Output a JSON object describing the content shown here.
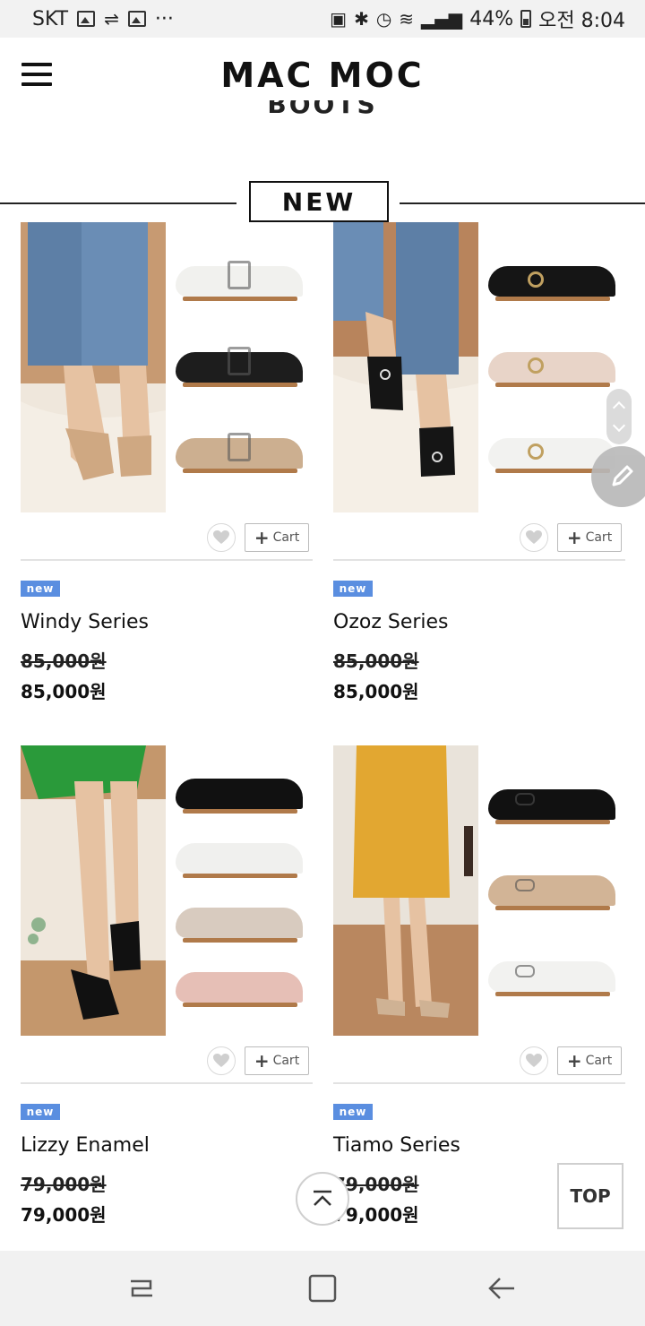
{
  "status_bar": {
    "carrier": "SKT",
    "dots": "···",
    "battery": "44%",
    "time": "오전 8:04"
  },
  "header": {
    "logo": "MAC MOC",
    "cut_heading": "BOOTS"
  },
  "section": {
    "title": "NEW"
  },
  "products": [
    {
      "name": "Windy Series",
      "old_price": "85,000원",
      "price": "85,000원",
      "badge": "new",
      "cart_label": "Cart"
    },
    {
      "name": "Ozoz Series",
      "old_price": "85,000원",
      "price": "85,000원",
      "badge": "new",
      "cart_label": "Cart"
    },
    {
      "name": "Lizzy Enamel",
      "old_price": "79,000원",
      "price": "79,000원",
      "badge": "new",
      "cart_label": "Cart"
    },
    {
      "name": "Tiamo Series",
      "old_price": "79,000원",
      "price": "79,000원",
      "badge": "new",
      "cart_label": "Cart"
    }
  ],
  "floating": {
    "top_label": "TOP"
  },
  "colors": {
    "badge": "#5a8ee0",
    "nav_bar": "#f1f1f1"
  }
}
